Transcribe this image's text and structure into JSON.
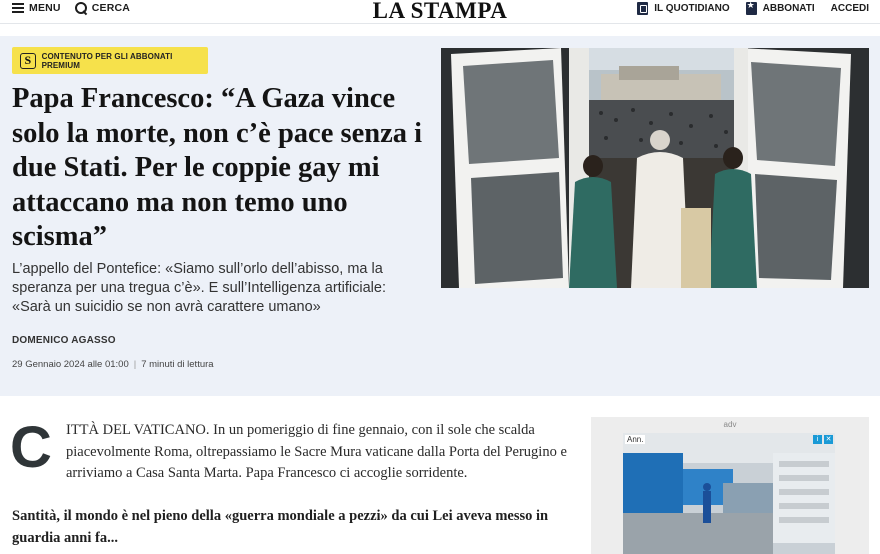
{
  "header": {
    "menu_label": "MENU",
    "search_label": "CERCA",
    "logo": "LA STAMPA",
    "quotidiano_label": "IL QUOTIDIANO",
    "abbonati_label": "ABBONATI",
    "accedi_label": "ACCEDI"
  },
  "article": {
    "badge_letter": "S",
    "badge_text": "CONTENUTO PER GLI ABBONATI PREMIUM",
    "title": "Papa Francesco: “A Gaza vince solo la morte, non c’è pace senza i due Stati. Per le coppie gay mi attaccano ma non temo uno scisma”",
    "summary": "L’appello del Pontefice: «Siamo sull’orlo dell’abisso, ma la speranza per una tregua c’è». E sull’Intelligenza artificiale: «Sarà un suicidio se non avrà carattere umano»",
    "author": "DOMENICO AGASSO",
    "date": "29 Gennaio 2024 alle 01:00",
    "separator": "|",
    "reading_time": "7 minuti di lettura",
    "dropcap": "C",
    "lead": "ITTÀ DEL VATICANO. In un pomeriggio di fine gennaio, con il sole che scalda piacevolmente Roma, oltrepassiamo le Sacre Mura vaticane dalla Porta del Perugino e arriviamo a Casa Santa Marta. Papa Francesco ci accoglie sorridente.",
    "question": "Santità, il mondo è nel pieno della «guerra mondiale a pezzi» da cui Lei aveva messo in guardia anni fa..."
  },
  "ad": {
    "label": "adv",
    "tag": "Ann."
  },
  "colors": {
    "hero_bg": "#edf1f8",
    "badge_yellow": "#f6e14b",
    "brand_navy": "#1f2a44"
  }
}
